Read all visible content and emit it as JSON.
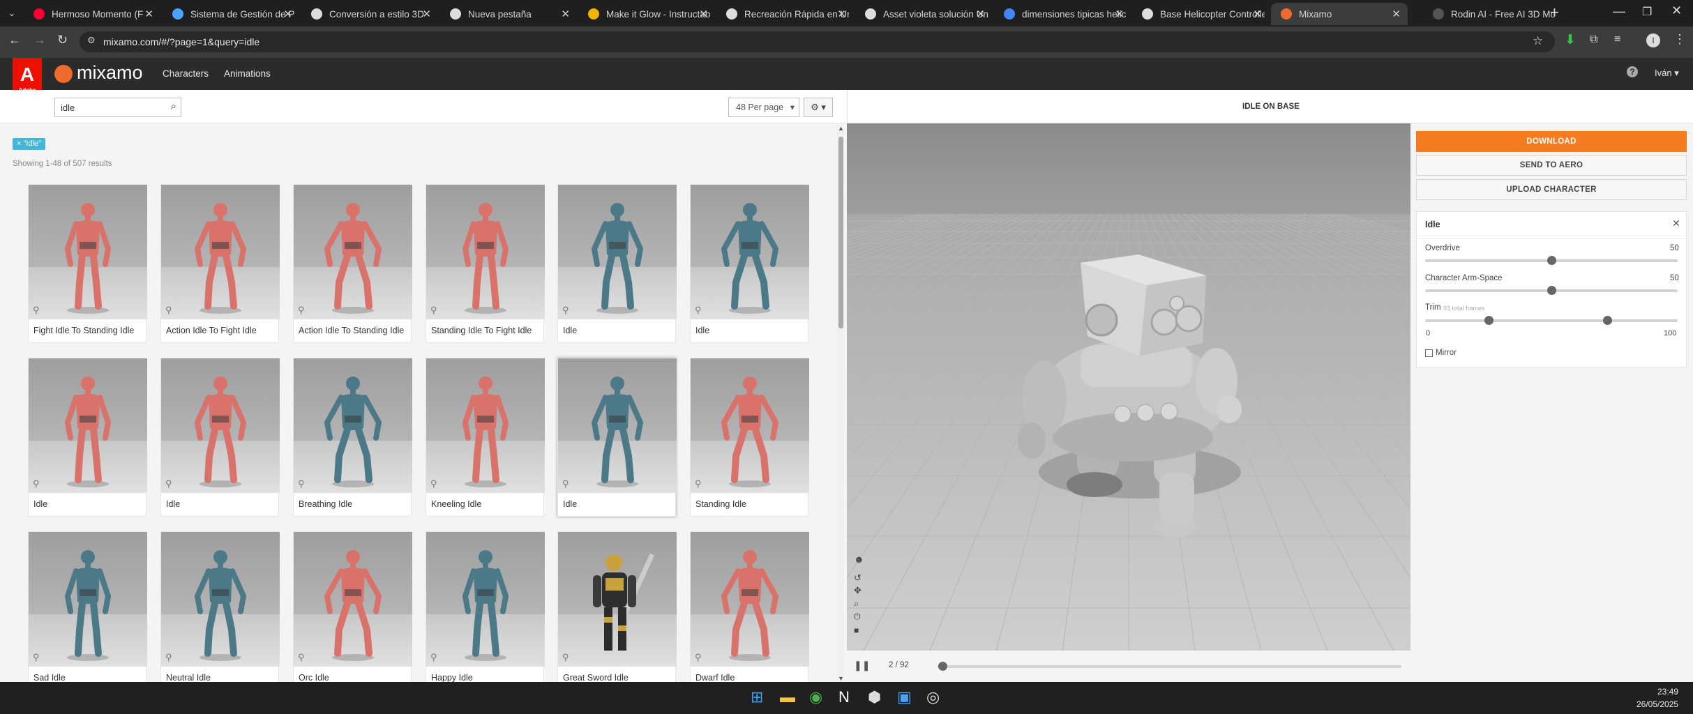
{
  "browser": {
    "tabs": [
      {
        "title": "Hermoso Momento (F",
        "icon": "youtube-icon",
        "color": "#ff0033"
      },
      {
        "title": "Sistema de Gestión de Pr",
        "icon": "gemini-icon",
        "color": "#4aa3ff"
      },
      {
        "title": "Conversión a estilo 3D",
        "icon": "openai-icon",
        "color": "#dddddd"
      },
      {
        "title": "Nueva pestaña",
        "icon": "openai-icon",
        "color": "#dddddd"
      },
      {
        "title": "Make it Glow - Instructabl",
        "icon": "instructables-icon",
        "color": "#f0b500"
      },
      {
        "title": "Recreación Rápida en Uni",
        "icon": "refresh-icon",
        "color": "#dddddd"
      },
      {
        "title": "Asset violeta solución Uni",
        "icon": "openai-icon",
        "color": "#dddddd"
      },
      {
        "title": "dimensiones tipicas helic",
        "icon": "google-icon",
        "color": "#4285f4"
      },
      {
        "title": "Base Helicopter Controlle",
        "icon": "unity-icon",
        "color": "#dddddd"
      },
      {
        "title": "Mixamo",
        "icon": "mixamo-icon",
        "color": "#ef6a2d"
      },
      {
        "title": "Rodin AI - Free AI 3D Mo",
        "icon": "rodin-icon",
        "color": "#555555"
      }
    ],
    "url": "mixamo.com/#/?page=1&query=idle",
    "profile_initial": "I"
  },
  "header": {
    "brand": "mixamo",
    "adobe_label": "Adobe",
    "nav": [
      "Characters",
      "Animations"
    ],
    "help_icon": "help-icon",
    "user": "Iván"
  },
  "toolbar": {
    "search_value": "idle",
    "per_page": "48 Per page",
    "settings_icon": "gear-icon"
  },
  "filter": {
    "tag": "× \"Idle\"",
    "results": "Showing 1-48 of 507 results"
  },
  "cards": [
    {
      "label": "Fight Idle To Standing Idle",
      "skin": "red"
    },
    {
      "label": "Action Idle To Fight Idle",
      "skin": "red"
    },
    {
      "label": "Action Idle To Standing Idle",
      "skin": "red"
    },
    {
      "label": "Standing Idle To Fight Idle",
      "skin": "red"
    },
    {
      "label": "Idle",
      "skin": "blue"
    },
    {
      "label": "Idle",
      "skin": "blue"
    },
    {
      "label": "Idle",
      "skin": "red"
    },
    {
      "label": "Idle",
      "skin": "red"
    },
    {
      "label": "Breathing Idle",
      "skin": "blue"
    },
    {
      "label": "Kneeling Idle",
      "skin": "red"
    },
    {
      "label": "Idle",
      "skin": "blue"
    },
    {
      "label": "Standing Idle",
      "skin": "red"
    },
    {
      "label": "Sad Idle",
      "skin": "blue"
    },
    {
      "label": "Neutral Idle",
      "skin": "blue"
    },
    {
      "label": "Orc Idle",
      "skin": "red"
    },
    {
      "label": "Happy Idle",
      "skin": "blue"
    },
    {
      "label": "Great Sword Idle",
      "skin": "knight"
    },
    {
      "label": "Dwarf Idle",
      "skin": "red"
    }
  ],
  "viewer": {
    "title": "IDLE ON BASE",
    "frame": "2 / 92",
    "frame_current": 2,
    "frame_total": 92
  },
  "actions": {
    "download": "DOWNLOAD",
    "send": "SEND TO AERO",
    "upload": "UPLOAD CHARACTER"
  },
  "settings": {
    "title": "Idle",
    "overdrive_label": "Overdrive",
    "overdrive_value": "50",
    "overdrive": 50,
    "armspace_label": "Character Arm-Space",
    "armspace_value": "50",
    "armspace": 50,
    "trim_label": "Trim",
    "trim_note": "93 total frames",
    "trim_min": "0",
    "trim_max": "100",
    "trim_start": 25,
    "trim_end": 72,
    "mirror_label": "Mirror"
  },
  "taskbar": {
    "time": "23:49",
    "date": "26/05/2025",
    "apps": [
      "windows-start-icon",
      "file-explorer-icon",
      "chrome-icon",
      "notion-icon",
      "unity-hub-icon",
      "photos-icon",
      "chrome-dev-icon"
    ]
  },
  "colors": {
    "accent": "#f47b20",
    "tag": "#45b5d9",
    "red_skin": "#d9726b",
    "blue_skin": "#4c7988"
  }
}
